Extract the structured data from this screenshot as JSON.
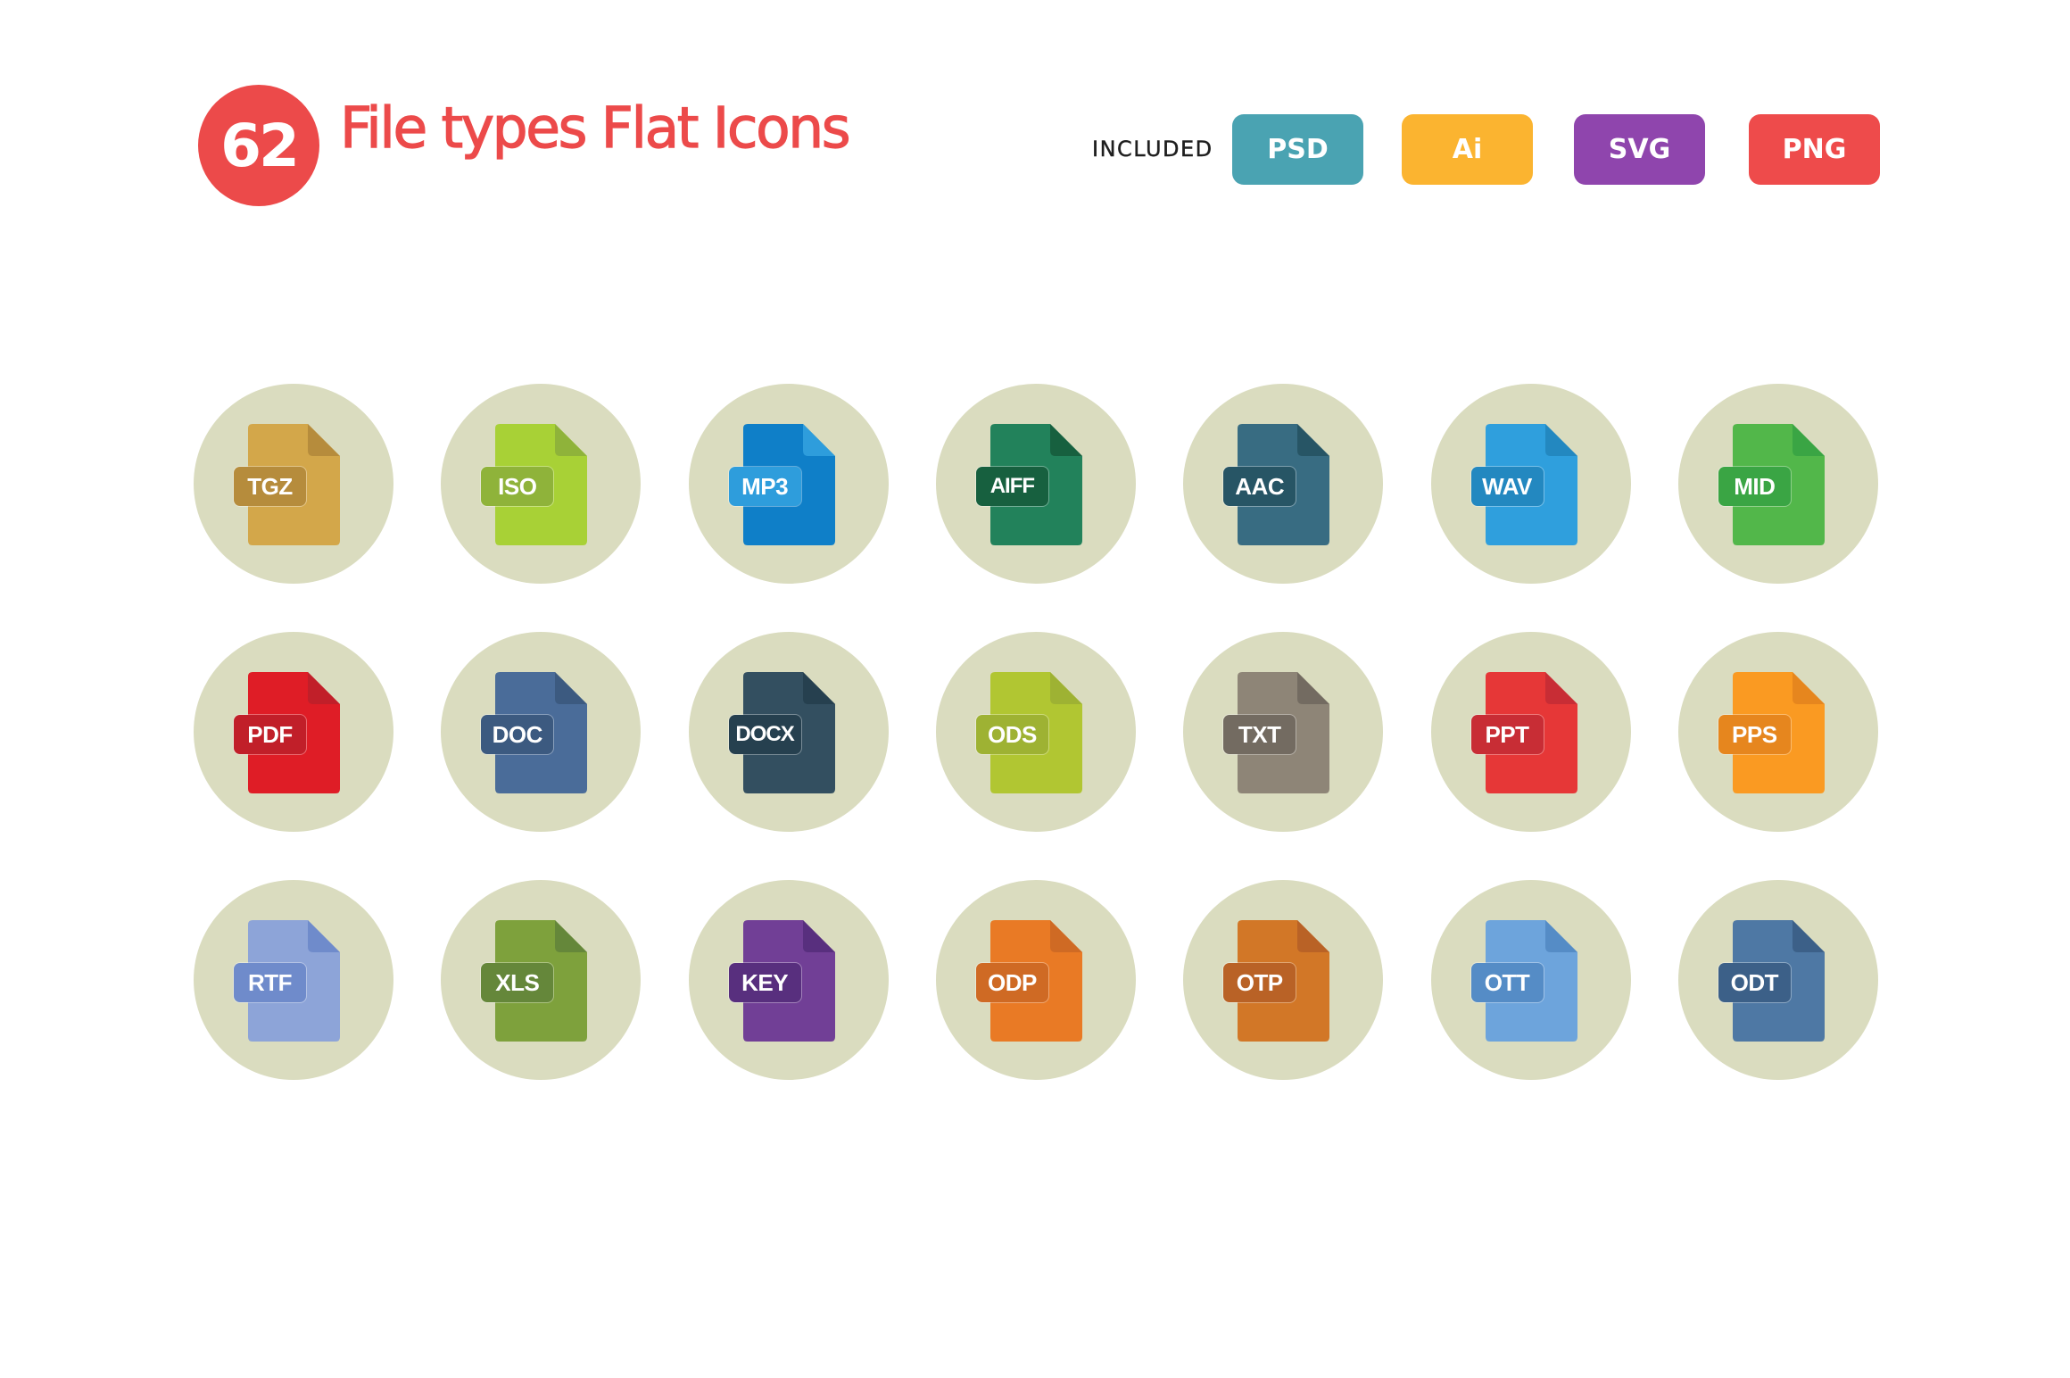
{
  "header": {
    "count": "62",
    "title": "File types Flat Icons",
    "included_label": "INCLUDED",
    "accent_color": "#ec4a4a",
    "formats": [
      {
        "label": "PSD",
        "color": "#4aa3b2"
      },
      {
        "label": "Ai",
        "color": "#fbb430"
      },
      {
        "label": "SVG",
        "color": "#8f45ad"
      },
      {
        "label": "PNG",
        "color": "#ee4b4b"
      }
    ]
  },
  "icon_grid": {
    "circle_color": "#dadcbf",
    "rows": [
      [
        {
          "ext": "TGZ",
          "body": "#d3a74a",
          "dark": "#b68c3c"
        },
        {
          "ext": "ISO",
          "body": "#a8d136",
          "dark": "#8fb33a"
        },
        {
          "ext": "MP3",
          "body": "#0f7fc8",
          "dark": "#2e9ddc"
        },
        {
          "ext": "AIFF",
          "body": "#22825b",
          "dark": "#17603f"
        },
        {
          "ext": "AAC",
          "body": "#386c82",
          "dark": "#275565"
        },
        {
          "ext": "WAV",
          "body": "#2f9fdd",
          "dark": "#2388c0"
        },
        {
          "ext": "MID",
          "body": "#52b74a",
          "dark": "#3aa544"
        }
      ],
      [
        {
          "ext": "PDF",
          "body": "#df1d26",
          "dark": "#c11f29"
        },
        {
          "ext": "DOC",
          "body": "#4a6c99",
          "dark": "#3c5a80"
        },
        {
          "ext": "DOCX",
          "body": "#334f60",
          "dark": "#26404f"
        },
        {
          "ext": "ODS",
          "body": "#b1c632",
          "dark": "#9eb233"
        },
        {
          "ext": "TXT",
          "body": "#8e8577",
          "dark": "#736b61"
        },
        {
          "ext": "PPT",
          "body": "#e63737",
          "dark": "#c82d35"
        },
        {
          "ext": "PPS",
          "body": "#fa9a22",
          "dark": "#e6861e"
        }
      ],
      [
        {
          "ext": "RTF",
          "body": "#8da4d8",
          "dark": "#6f8bcb"
        },
        {
          "ext": "XLS",
          "body": "#7ea13c",
          "dark": "#65873a"
        },
        {
          "ext": "KEY",
          "body": "#713f96",
          "dark": "#582f7e"
        },
        {
          "ext": "ODP",
          "body": "#e97a25",
          "dark": "#cf6a24"
        },
        {
          "ext": "OTP",
          "body": "#d27727",
          "dark": "#b96226"
        },
        {
          "ext": "OTT",
          "body": "#6da4dc",
          "dark": "#558cc6"
        },
        {
          "ext": "ODT",
          "body": "#4e78a4",
          "dark": "#3c6088"
        }
      ]
    ]
  }
}
